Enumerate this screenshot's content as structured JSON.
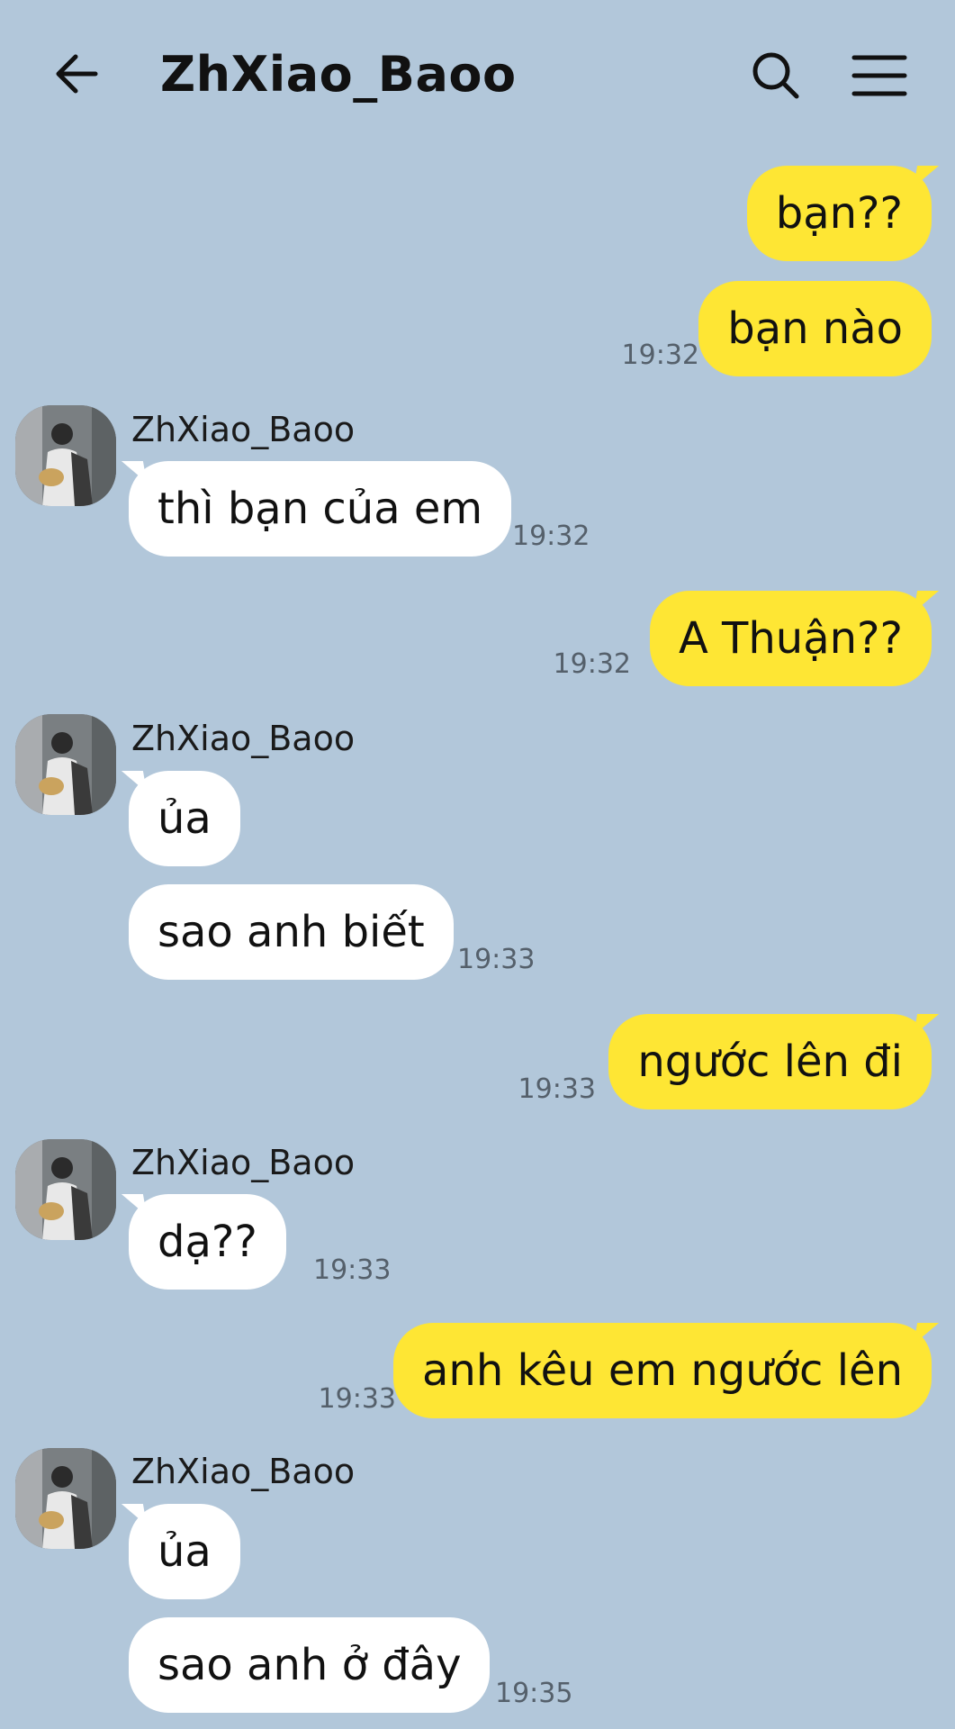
{
  "header": {
    "title": "ZhXiao_Baoo",
    "back_icon": "arrow-left-icon",
    "search_icon": "search-icon",
    "menu_icon": "hamburger-menu-icon"
  },
  "colors": {
    "background": "#b2c7da",
    "outgoing_bubble": "#fee634",
    "incoming_bubble": "#ffffff"
  },
  "messages": [
    {
      "dir": "out",
      "text": "bạn??",
      "time": ""
    },
    {
      "dir": "out",
      "text": "bạn nào",
      "time": "19:32"
    },
    {
      "dir": "in",
      "sender": "ZhXiao_Baoo",
      "text": "thì bạn của em",
      "time": "19:32"
    },
    {
      "dir": "out",
      "text": "A Thuận??",
      "time": "19:32"
    },
    {
      "dir": "in",
      "sender": "ZhXiao_Baoo",
      "text": "ủa",
      "time": ""
    },
    {
      "dir": "in",
      "text": "sao anh biết",
      "time": "19:33"
    },
    {
      "dir": "out",
      "text": "ngước lên đi",
      "time": "19:33"
    },
    {
      "dir": "in",
      "sender": "ZhXiao_Baoo",
      "text": "dạ??",
      "time": "19:33"
    },
    {
      "dir": "out",
      "text": "anh kêu em ngước lên",
      "time": "19:33"
    },
    {
      "dir": "in",
      "sender": "ZhXiao_Baoo",
      "text": "ủa",
      "time": ""
    },
    {
      "dir": "in",
      "text": "sao anh ở đây",
      "time": "19:35"
    }
  ]
}
